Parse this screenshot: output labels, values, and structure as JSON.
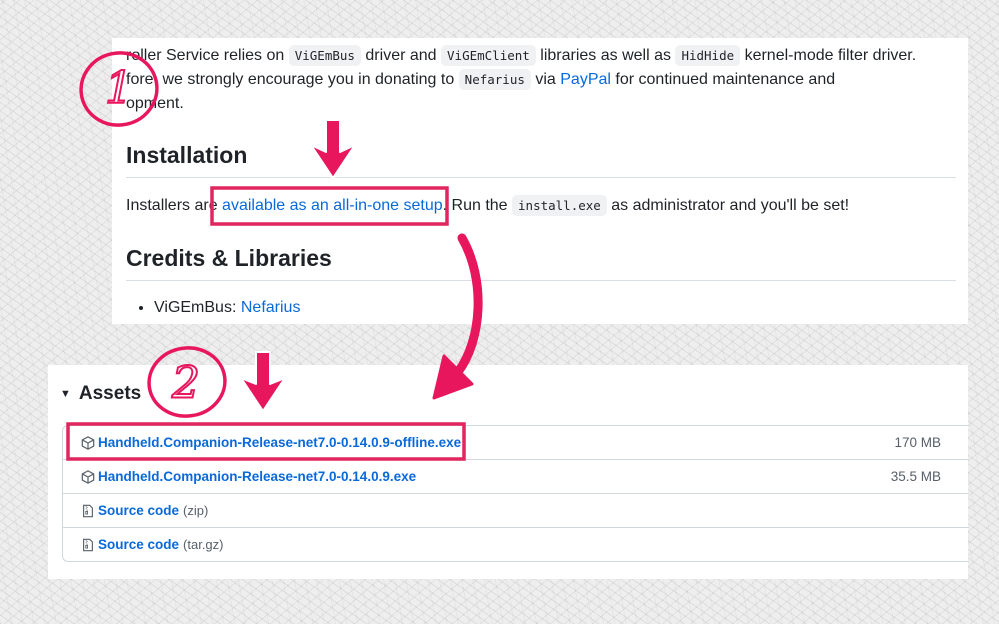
{
  "readme": {
    "para1_prefix": "roller Service relies on",
    "code1": "ViGEmBus",
    "para1_mid1": "driver and",
    "code2": "ViGEmClient",
    "para1_mid2": "libraries as well as",
    "code3": "HidHide",
    "para1_suffix": "kernel-mode filter driver.",
    "para2_prefix": "fore, we strongly encourage you in donating to",
    "code4": "Nefarius",
    "para2_via": "via",
    "paypal_link": "PayPal",
    "para2_suffix": "for continued maintenance and",
    "para3": "opment.",
    "installation_heading": "Installation",
    "install_prefix": "Installers are",
    "install_link": "available as an all-in-one setup",
    "install_mid": ". Run the",
    "install_code": "install.exe",
    "install_suffix": "as administrator and you'll be set!",
    "credits_heading": "Credits & Libraries",
    "lib_item_label": "ViGEmBus:",
    "lib_item_link": "Nefarius"
  },
  "assets": {
    "title": "Assets",
    "items": [
      {
        "name": "Handheld.Companion-Release-net7.0-0.14.0.9-offline.exe",
        "suffix": "",
        "size": "170 MB",
        "icon": "package-icon"
      },
      {
        "name": "Handheld.Companion-Release-net7.0-0.14.0.9.exe",
        "suffix": "",
        "size": "35.5 MB",
        "icon": "package-icon"
      },
      {
        "name": "Source code",
        "suffix": "(zip)",
        "size": "",
        "icon": "file-zip-icon"
      },
      {
        "name": "Source code",
        "suffix": "(tar.gz)",
        "size": "",
        "icon": "file-zip-icon"
      }
    ]
  },
  "annotations": {
    "step1": "1",
    "step2": "2",
    "color": "#e8175d"
  }
}
